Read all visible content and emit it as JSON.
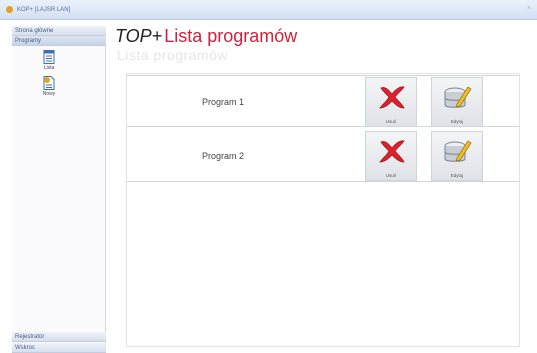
{
  "window": {
    "title": "KOP+ [LAJSR LAN]"
  },
  "sidebar": {
    "headers_top": [
      "Strona główne",
      "Programy"
    ],
    "items": [
      {
        "label": "Lista",
        "icon": "list-document-icon"
      },
      {
        "label": "Nowy",
        "icon": "new-document-icon"
      }
    ],
    "headers_bottom": [
      "Rejestrator",
      "Wskroc"
    ]
  },
  "page": {
    "brand": "TOP+",
    "title": "Lista programów",
    "reflection": "Lista programów"
  },
  "programs": [
    {
      "name": "Program 1",
      "delete_label": "Usuń",
      "edit_label": "Edytuj"
    },
    {
      "name": "Program 2",
      "delete_label": "Usuń",
      "edit_label": "Edytuj"
    }
  ],
  "colors": {
    "accent": "#d0203a",
    "delete_icon": "#d9232e",
    "db_icon": "#8a8f99"
  }
}
